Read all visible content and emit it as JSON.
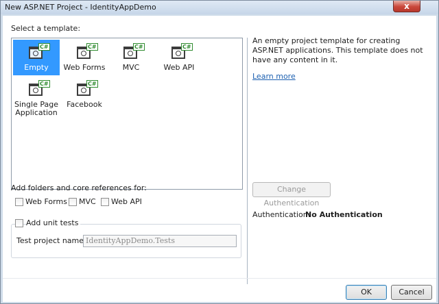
{
  "window": {
    "title": "New ASP.NET Project - IdentityAppDemo",
    "close_glyph": "x"
  },
  "templates": {
    "heading": "Select a template:",
    "items": [
      {
        "label": "Empty",
        "selected": true,
        "icon": "web-project-icon"
      },
      {
        "label": "Web Forms",
        "selected": false,
        "icon": "web-project-icon"
      },
      {
        "label": "MVC",
        "selected": false,
        "icon": "web-project-icon"
      },
      {
        "label": "Web API",
        "selected": false,
        "icon": "web-project-icon"
      },
      {
        "label": "Single Page Application",
        "selected": false,
        "icon": "web-project-icon"
      },
      {
        "label": "Facebook",
        "selected": false,
        "icon": "web-project-icon"
      }
    ],
    "icon_badge": "C#"
  },
  "description": {
    "text": "An empty project template for creating ASP.NET applications. This template does not have any content in it.",
    "learn_more": "Learn more"
  },
  "folders": {
    "heading": "Add folders and core references for:",
    "options": [
      {
        "label": "Web Forms",
        "checked": false
      },
      {
        "label": "MVC",
        "checked": false
      },
      {
        "label": "Web API",
        "checked": false
      }
    ]
  },
  "unit_tests": {
    "label": "Add unit tests",
    "checked": false,
    "project_name_label": "Test project name:",
    "project_name_value": "IdentityAppDemo.Tests"
  },
  "authentication": {
    "change_button": "Change Authentication",
    "label": "Authentication:",
    "value": "No Authentication"
  },
  "buttons": {
    "ok": "OK",
    "cancel": "Cancel"
  },
  "colors": {
    "selection": "#3399ff",
    "link": "#1b5fb0",
    "title_bar": "#c6d6e8"
  }
}
